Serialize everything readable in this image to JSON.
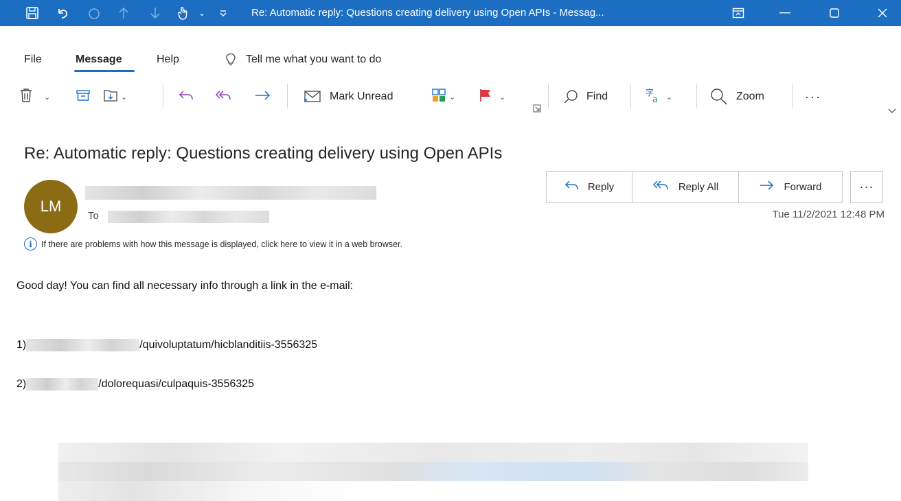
{
  "titlebar": {
    "title": "Re: Automatic reply: Questions creating delivery using Open APIs  -  Messag...",
    "icons": [
      "save-icon",
      "undo-icon",
      "redo-icon",
      "up-arrow-icon",
      "down-arrow-icon",
      "touch-mode-icon",
      "customize-icon"
    ],
    "accent": "#1b6ec2"
  },
  "menu": {
    "file": "File",
    "message": "Message",
    "help": "Help",
    "tell_me": "Tell me what you want to do"
  },
  "toolbar": {
    "mark_unread": "Mark Unread",
    "find": "Find",
    "zoom": "Zoom",
    "more": "···"
  },
  "message": {
    "subject": "Re: Automatic reply: Questions creating delivery using Open APIs",
    "avatar_initials": "LM",
    "avatar_color": "#8b6b14",
    "to_label": "To",
    "date": "Tue 11/2/2021 12:48 PM",
    "info_text": "If there are problems with how this message is displayed, click here to view it in a web browser.",
    "reply_label": "Reply",
    "reply_all_label": "Reply All",
    "forward_label": "Forward",
    "more_label": "···"
  },
  "body": {
    "greeting": "Good day! You can find all necessary info through a link in the e-mail:",
    "item1_prefix": "1)",
    "item1_path": "/quivoluptatum/hicblanditiis-3556325",
    "item2_prefix": "2)",
    "item2_path": "/dolorequasi/culpaquis-3556325"
  }
}
